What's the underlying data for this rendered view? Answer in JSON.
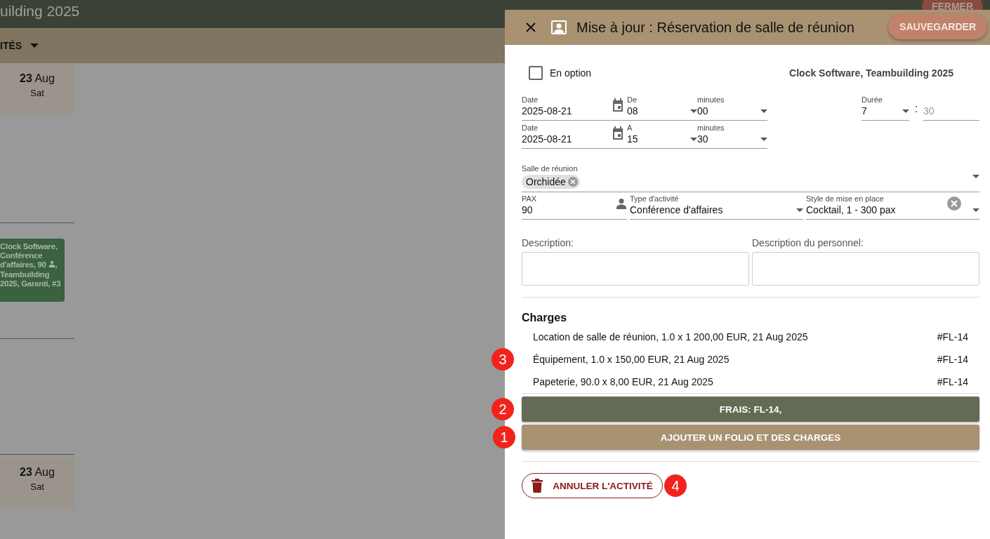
{
  "background": {
    "title": "uilding 2025",
    "close_button": "FERMER",
    "menu": "ITÉS",
    "days": [
      {
        "day": "23",
        "month": "Aug",
        "weekday": "Sat"
      },
      {
        "day": "23",
        "month": "Aug",
        "weekday": "Sat"
      }
    ],
    "event": {
      "text_before": "Clock Software, Conférence d'affaires, 90",
      "text_after": ", Teambuilding 2025, Garanti, #3"
    }
  },
  "drawer": {
    "title": "Mise à jour : Réservation de salle de réunion",
    "save_button": "SAUVEGARDER",
    "option": {
      "label": "En option",
      "checked": false
    },
    "context": "Clock Software, Teambuilding 2025",
    "time_rows": [
      {
        "date_label": "Date",
        "date": "2025-08-21",
        "hour_label": "De",
        "hour": "08",
        "minute_label": "minutes",
        "minute": "00"
      },
      {
        "date_label": "Date",
        "date": "2025-08-21",
        "hour_label": "A",
        "hour": "15",
        "minute_label": "minutes",
        "minute": "30"
      }
    ],
    "duration": {
      "label": "Durée",
      "hours": "7",
      "separator": ":",
      "minutes": "30",
      "minutes_disabled": true
    },
    "room": {
      "label": "Salle de réunion",
      "chips": [
        "Orchidée"
      ]
    },
    "pax": {
      "label": "PAX",
      "value": "90"
    },
    "activity_type": {
      "label": "Type d'activité",
      "value": "Conférence d'affaires"
    },
    "setup_style": {
      "label": "Style de mise en place",
      "value": "Cocktail, 1 - 300 pax"
    },
    "descriptions": [
      {
        "label": "Description:"
      },
      {
        "label": "Description du personnel:"
      }
    ],
    "charges": {
      "title": "Charges",
      "callout": "3",
      "items": [
        {
          "text": "Location de salle de réunion, 1.0 x 1 200,00 EUR, 21 Aug 2025",
          "folio": "#FL-14"
        },
        {
          "text": "Équipement, 1.0 x 150,00 EUR, 21 Aug 2025",
          "folio": "#FL-14"
        },
        {
          "text": "Papeterie, 90.0 x 8,00 EUR, 21 Aug 2025",
          "folio": "#FL-14"
        }
      ]
    },
    "fees_button": {
      "label": "FRAIS: FL-14,",
      "callout": "2"
    },
    "add_button": {
      "label": "AJOUTER UN FOLIO ET DES CHARGES",
      "callout": "1"
    },
    "cancel_button": {
      "label": "ANNULER L'ACTIVITÉ",
      "callout": "4"
    }
  }
}
